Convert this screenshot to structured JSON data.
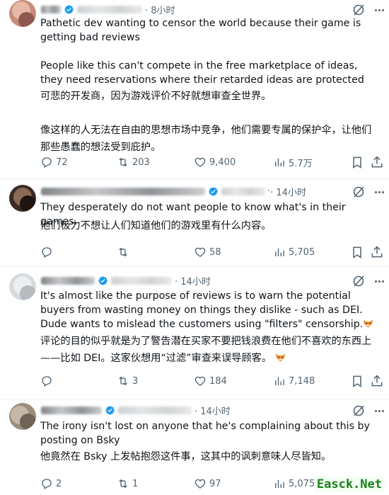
{
  "posts": [
    {
      "time": "· 8小时",
      "text_en": "Pathetic dev wanting to censor the world because their game is getting bad reviews\n\nPeople like this can't compete in the free marketplace of ideas, they need reservations where their retarded ideas are protected",
      "text_cn": "可悲的开发商，因为游戏评价不好就想审查全世界。\n\n像这样的人无法在自由的思想市场中竞争，他们需要专属的保护伞，让他们那些愚蠢的想法受到庇护。",
      "replies": "72",
      "reposts": "203",
      "likes": "9,400",
      "views": "5.7万"
    },
    {
      "time": "· 14小时",
      "text_en": "They desperately do not want people to know what's in their games.",
      "text_cn": "他们极力不想让人们知道他们的游戏里有什么内容。",
      "replies": "",
      "reposts": "",
      "likes": "58",
      "views": "5,705"
    },
    {
      "time": "· 14小时",
      "text_en": "It's almost like the purpose of reviews is to warn the potential buyers from wasting money on things they dislike - such as DEI. Dude wants to mislead the customers using \"filters\" censorship.",
      "text_cn": "评论的目的似乎就是为了警告潜在买家不要把钱浪费在他们不喜欢的东西上——比如 DEI。这家伙想用“过滤”审查来误导顾客。",
      "replies": "",
      "reposts": "3",
      "likes": "184",
      "views": "7,148"
    },
    {
      "time": "· 14小时",
      "text_en": "The irony isn't lost on anyone that he's complaining about this by posting on Bsky",
      "text_cn": "他竟然在 Bsky 上发帖抱怨这件事，这其中的讽刺意味人尽皆知。",
      "replies": "2",
      "reposts": "1",
      "likes": "97",
      "views": "5,075"
    }
  ],
  "watermark": "Easck.Net",
  "colors": {
    "verified": "#1d9bf0",
    "muted": "#536471",
    "text": "#0f1419"
  }
}
